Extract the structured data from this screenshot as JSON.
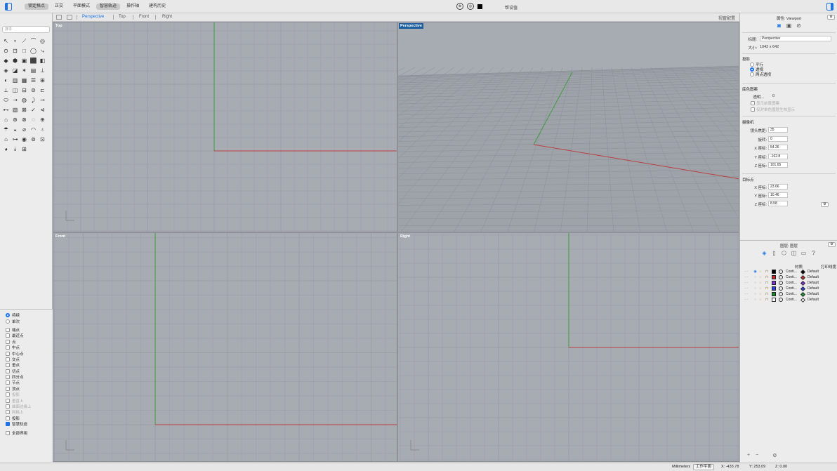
{
  "toolbar": {
    "modes": [
      "锁定格点",
      "正交",
      "平面模式",
      "智慧轨迹",
      "操作轴",
      "建构历史"
    ],
    "modes_on": [
      true,
      false,
      false,
      true,
      false,
      false
    ],
    "hint": "帮设值"
  },
  "left_panel": {
    "search_placeholder": "搜寻",
    "tools": [
      "↖",
      "∘",
      "⟋",
      "⌒",
      "◎",
      "⊙",
      "⊡",
      "□",
      "◯",
      "⤷",
      "◆",
      "⬢",
      "▣",
      "⬛",
      "◧",
      "◈",
      "◪",
      "✶",
      "▤",
      "⊥",
      "◐",
      "▥",
      "▦",
      "☰",
      "⊞",
      "⟂",
      "◫",
      "⊟",
      "⊜",
      "⊏",
      "⬭",
      "⇢",
      "◍",
      "⤸",
      "⊸",
      "⊷",
      "▧",
      "⊠",
      "✓",
      "⊲",
      "⌂",
      "⊛",
      "⊗",
      "◌",
      "⊕",
      "☂",
      "◒",
      "⌀",
      "◠",
      "♁",
      "⌂",
      "⊶",
      "◉",
      "⊚",
      "⊡",
      "◕",
      "⇣",
      "⊞"
    ],
    "snap_mode": [
      {
        "label": "持续",
        "on": true
      },
      {
        "label": "单次",
        "on": false
      }
    ],
    "osnaps": [
      {
        "label": "端点",
        "on": false,
        "dim": false
      },
      {
        "label": "最近点",
        "on": false,
        "dim": false
      },
      {
        "label": "点",
        "on": false,
        "dim": false
      },
      {
        "label": "中点",
        "on": false,
        "dim": false
      },
      {
        "label": "中心点",
        "on": false,
        "dim": false
      },
      {
        "label": "交点",
        "on": false,
        "dim": false
      },
      {
        "label": "垂点",
        "on": false,
        "dim": false
      },
      {
        "label": "切点",
        "on": false,
        "dim": false
      },
      {
        "label": "四分点",
        "on": false,
        "dim": false
      },
      {
        "label": "节点",
        "on": false,
        "dim": false
      },
      {
        "label": "顶点",
        "on": false,
        "dim": false
      },
      {
        "label": "投影",
        "on": false,
        "dim": true
      },
      {
        "label": "垂直上",
        "on": false,
        "dim": true
      },
      {
        "label": "曲面边缘上",
        "on": false,
        "dim": true
      },
      {
        "label": "网格上",
        "on": false,
        "dim": true
      },
      {
        "label": "投影",
        "on": false,
        "dim": false
      },
      {
        "label": "智慧轨迹",
        "on": true,
        "dim": false
      }
    ],
    "disable_all": "全部停用"
  },
  "viewport_tabs": {
    "tabs": [
      "Perspective",
      "Top",
      "Front",
      "Right"
    ],
    "active": "Perspective",
    "right_label": "视窗配置"
  },
  "viewports": {
    "top": "Top",
    "perspective": "Perspective",
    "front": "Front",
    "right": "Right"
  },
  "properties": {
    "header": "属性: Viewport",
    "title_label": "标题:",
    "title_value": "Perspective",
    "size_label": "大小:",
    "size_value": "1042 x 642",
    "projection_label": "投影",
    "projections": [
      {
        "label": "平行",
        "on": false
      },
      {
        "label": "透视",
        "on": true
      },
      {
        "label": "两点透视",
        "on": false
      }
    ],
    "background_label": "底色图案",
    "transparency_label": "透明...",
    "transparency_value": "0",
    "bg_opts": [
      "显示前景图案",
      "仅对单色图层生效显示"
    ],
    "camera_label": "摄像机",
    "camera_fields": [
      {
        "label": "镜头焦距:",
        "value": "35"
      },
      {
        "label": "旋转:",
        "value": "0"
      },
      {
        "label": "X 座标:",
        "value": "54.26"
      },
      {
        "label": "Y 座标:",
        "value": "-162.8"
      },
      {
        "label": "Z 座标:",
        "value": "101.65"
      }
    ],
    "target_label": "目标点",
    "target_fields": [
      {
        "label": "X 座标:",
        "value": "23.66"
      },
      {
        "label": "Y 座标:",
        "value": "10.46"
      },
      {
        "label": "Z 座标:",
        "value": "8.58"
      }
    ]
  },
  "layers": {
    "header": "图层: 图层",
    "col_material": "材质",
    "col_print": "打印线宽",
    "rows": [
      {
        "color": "#000000",
        "linetype": "Conti...",
        "print": "Default",
        "current": true
      },
      {
        "color": "#c0282a",
        "linetype": "Conti...",
        "print": "Default",
        "current": false
      },
      {
        "color": "#7d35c9",
        "linetype": "Conti...",
        "print": "Default",
        "current": false
      },
      {
        "color": "#2d3fd8",
        "linetype": "Conti...",
        "print": "Default",
        "current": false
      },
      {
        "color": "#1a8c2a",
        "linetype": "Conti...",
        "print": "Default",
        "current": false
      },
      {
        "color": "#ffffff",
        "linetype": "Conti...",
        "print": "Default",
        "current": false
      }
    ]
  },
  "status": {
    "units": "Millimeters",
    "plane": "工作平面",
    "x": "X: -433.78",
    "y": "Y: 253.09",
    "z": "Z: 0.00"
  }
}
